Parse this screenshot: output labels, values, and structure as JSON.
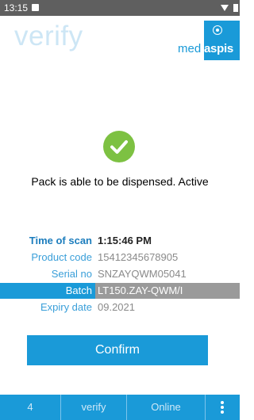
{
  "status_bar": {
    "time": "13:15"
  },
  "header": {
    "app_title": "verify",
    "logo_left": "med",
    "logo_right": "aspis"
  },
  "result": {
    "message": "Pack is able to be dispensed. Active"
  },
  "details": [
    {
      "label": "Time of scan",
      "value": "1:15:46 PM"
    },
    {
      "label": "Product code",
      "value": "15412345678905"
    },
    {
      "label": "Serial no",
      "value": "SNZAYQWM05041"
    },
    {
      "label": "Batch",
      "value": "LT150.ZAY-QWM/I"
    },
    {
      "label": "Expiry date",
      "value": "09.2021"
    }
  ],
  "confirm_label": "Confirm",
  "bottom_bar": {
    "count": "4",
    "mode": "verify",
    "connection": "Online"
  },
  "colors": {
    "accent": "#1a9ad8",
    "success": "#7dc142",
    "highlight_row": "#9a9a9a"
  }
}
